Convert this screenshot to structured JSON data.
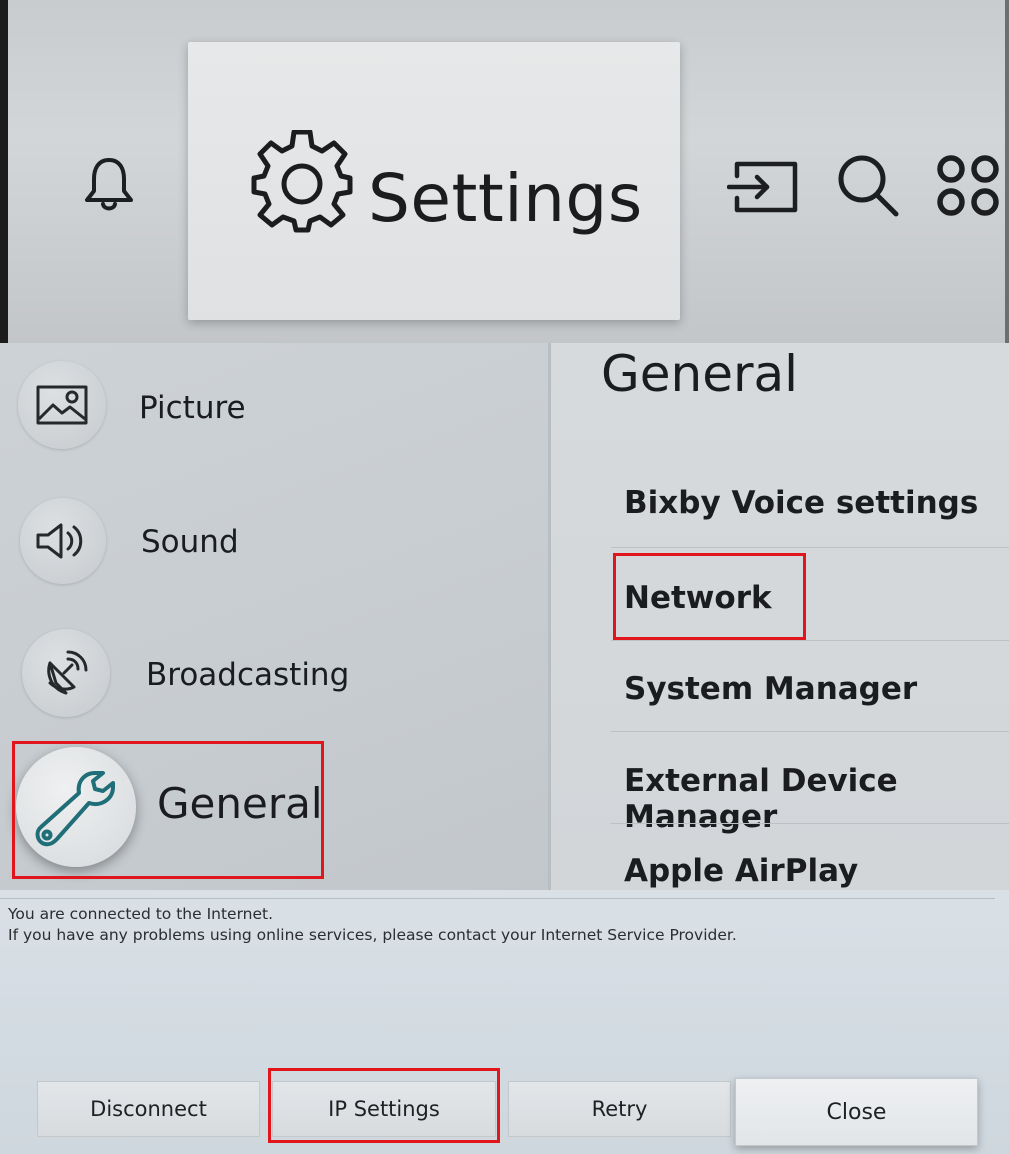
{
  "top_bar": {
    "settings_label": "Settings",
    "icons": [
      "bell-icon",
      "gear-icon",
      "source-input-icon",
      "search-icon",
      "apps-icon"
    ]
  },
  "menu": {
    "categories": [
      {
        "label": "Picture",
        "icon": "picture-icon"
      },
      {
        "label": "Sound",
        "icon": "sound-icon"
      },
      {
        "label": "Broadcasting",
        "icon": "broadcasting-icon"
      },
      {
        "label": "General",
        "icon": "wrench-icon",
        "selected": true
      }
    ],
    "panel_title": "General",
    "options": [
      {
        "label": "Bixby Voice settings"
      },
      {
        "label": "Network",
        "highlighted": true
      },
      {
        "label": "System Manager"
      },
      {
        "label": "External Device Manager"
      },
      {
        "label": "Apple AirPlay Settings"
      }
    ]
  },
  "dialog": {
    "message_line1": "You are connected to the Internet.",
    "message_line2": "If you have any problems using online services, please contact your Internet Service Provider.",
    "buttons": [
      {
        "label": "Disconnect"
      },
      {
        "label": "IP Settings",
        "highlighted": true
      },
      {
        "label": "Retry"
      },
      {
        "label": "Close",
        "focused": true
      }
    ]
  },
  "colors": {
    "highlight_box": "#e0161c",
    "wrench_accent": "#1f6e78"
  }
}
